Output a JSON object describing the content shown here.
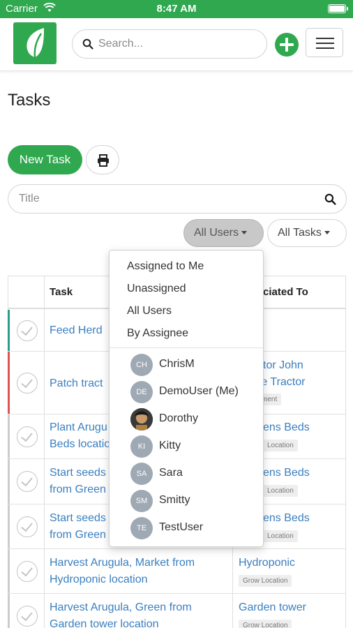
{
  "status_bar": {
    "carrier": "Carrier",
    "time": "8:47 AM"
  },
  "header": {
    "search_placeholder": "Search..."
  },
  "page": {
    "title": "Tasks",
    "new_task_label": "New Task",
    "title_filter_placeholder": "Title"
  },
  "filters": {
    "users": "All Users",
    "tasks": "All Tasks"
  },
  "table": {
    "columns": {
      "task": "Task",
      "associated": "ciated To"
    },
    "rows": [
      {
        "task": "Feed Herd",
        "associated": "",
        "tag": "",
        "bar_color": "#2a9d8f"
      },
      {
        "task": "Patch tract",
        "associated": "ctor John\nre Tractor",
        "tag": "ment",
        "bar_color": "#e05252"
      },
      {
        "task": "Plant Arugu\nBeds locatio",
        "associated": "ens Beds",
        "tag": "Location",
        "bar_color": "#cccccc"
      },
      {
        "task": "Start seeds\nfrom Green",
        "associated": "ens Beds",
        "tag": "Location",
        "bar_color": "#cccccc"
      },
      {
        "task": "Start seeds\nfrom Green",
        "associated": "ens Beds",
        "tag": "Location",
        "bar_color": "#cccccc"
      },
      {
        "task": "Harvest Arugula, Market from\nHydroponic location",
        "associated": "Hydroponic",
        "tag": "Grow Location",
        "bar_color": "#cccccc"
      },
      {
        "task": "Harvest Arugula, Green from\nGarden tower location",
        "associated": "Garden tower",
        "tag": "Grow Location",
        "bar_color": "#cccccc"
      }
    ]
  },
  "dropdown": {
    "options": [
      "Assigned to Me",
      "Unassigned",
      "All Users",
      "By Assignee"
    ],
    "users": [
      {
        "initials": "CH",
        "name": "ChrisM"
      },
      {
        "initials": "DE",
        "name": "DemoUser (Me)"
      },
      {
        "initials": "",
        "name": "Dorothy"
      },
      {
        "initials": "KI",
        "name": "Kitty"
      },
      {
        "initials": "SA",
        "name": "Sara"
      },
      {
        "initials": "SM",
        "name": "Smitty"
      },
      {
        "initials": "TE",
        "name": "TestUser"
      }
    ]
  },
  "colors": {
    "brand": "#2fa84f",
    "link": "#3a7fbf"
  }
}
